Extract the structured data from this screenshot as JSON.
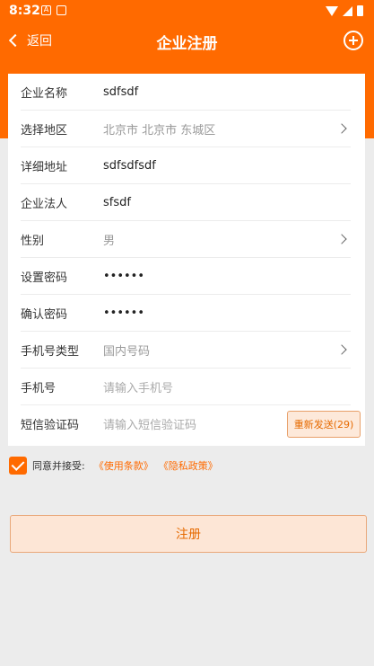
{
  "status_bar": {
    "time": "8:32"
  },
  "navbar": {
    "back_label": "返回",
    "title": "企业注册"
  },
  "form": {
    "rows": [
      {
        "label": "企业名称",
        "value": "sdfsdf"
      },
      {
        "label": "选择地区",
        "value": "北京市 北京市 东城区"
      },
      {
        "label": "详细地址",
        "value": "sdfsdfsdf"
      },
      {
        "label": "企业法人",
        "value": "sfsdf"
      },
      {
        "label": "性别",
        "value": "男"
      },
      {
        "label": "设置密码",
        "value": "••••••"
      },
      {
        "label": "确认密码",
        "value": "••••••"
      },
      {
        "label": "手机号类型",
        "value": "国内号码"
      },
      {
        "label": "手机号",
        "placeholder": "请输入手机号"
      },
      {
        "label": "短信验证码",
        "placeholder": "请输入短信验证码",
        "resend_label": "重新发送(29)"
      }
    ]
  },
  "agreement": {
    "text": "同意并接受:",
    "terms_link": "《使用条款》",
    "privacy_link": "《隐私政策》"
  },
  "submit": {
    "label": "注册"
  },
  "colors": {
    "accent": "#ff6a00",
    "background": "#ececec"
  }
}
